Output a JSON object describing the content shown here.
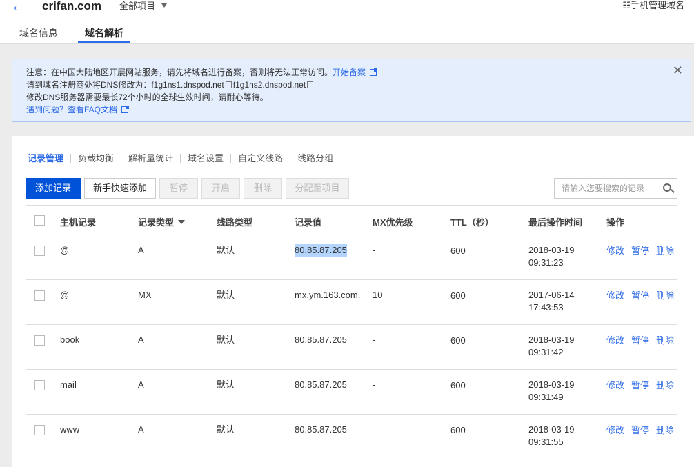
{
  "header": {
    "site": "crifan.com",
    "project": "全部项目",
    "mobile_manage": "手机管理域名"
  },
  "tabs": [
    {
      "label": "域名信息"
    },
    {
      "label": "域名解析"
    }
  ],
  "notice": {
    "line1": "注意：在中国大陆地区开展网站服务，请先将域名进行备案，否则将无法正常访问。",
    "line1_link": "开始备案",
    "line2_prefix": "请到域名注册商处将DNS修改为：",
    "ns1": "f1g1ns1.dnspod.net",
    "ns2": "f1g1ns2.dnspod.net",
    "line3": "修改DNS服务器需要最长72个小时的全球生效时间，请耐心等待。",
    "faq": "遇到问题？查看FAQ文档"
  },
  "subtabs": [
    "记录管理",
    "负载均衡",
    "解析量统计",
    "域名设置",
    "自定义线路",
    "线路分组"
  ],
  "toolbar": {
    "add": "添加记录",
    "quick_add": "新手快速添加",
    "pause": "暂停",
    "enable": "开启",
    "delete": "删除",
    "assign": "分配至项目",
    "search_placeholder": "请输入您要搜索的记录"
  },
  "columns": [
    "主机记录",
    "记录类型",
    "线路类型",
    "记录值",
    "MX优先级",
    "TTL（秒）",
    "最后操作时间",
    "操作"
  ],
  "actions": [
    "修改",
    "暂停",
    "删除"
  ],
  "records": [
    {
      "host": "@",
      "type": "A",
      "line": "默认",
      "value": "80.85.87.205",
      "mx": "-",
      "ttl": "600",
      "date": "2018-03-19",
      "time": "09:31:23",
      "selected_value": true
    },
    {
      "host": "@",
      "type": "MX",
      "line": "默认",
      "value": "mx.ym.163.com.",
      "mx": "10",
      "ttl": "600",
      "date": "2017-06-14",
      "time": "17:43:53"
    },
    {
      "host": "book",
      "type": "A",
      "line": "默认",
      "value": "80.85.87.205",
      "mx": "-",
      "ttl": "600",
      "date": "2018-03-19",
      "time": "09:31:42"
    },
    {
      "host": "mail",
      "type": "A",
      "line": "默认",
      "value": "80.85.87.205",
      "mx": "-",
      "ttl": "600",
      "date": "2018-03-19",
      "time": "09:31:49"
    },
    {
      "host": "www",
      "type": "A",
      "line": "默认",
      "value": "80.85.87.205",
      "mx": "-",
      "ttl": "600",
      "date": "2018-03-19",
      "time": "09:31:55"
    }
  ]
}
